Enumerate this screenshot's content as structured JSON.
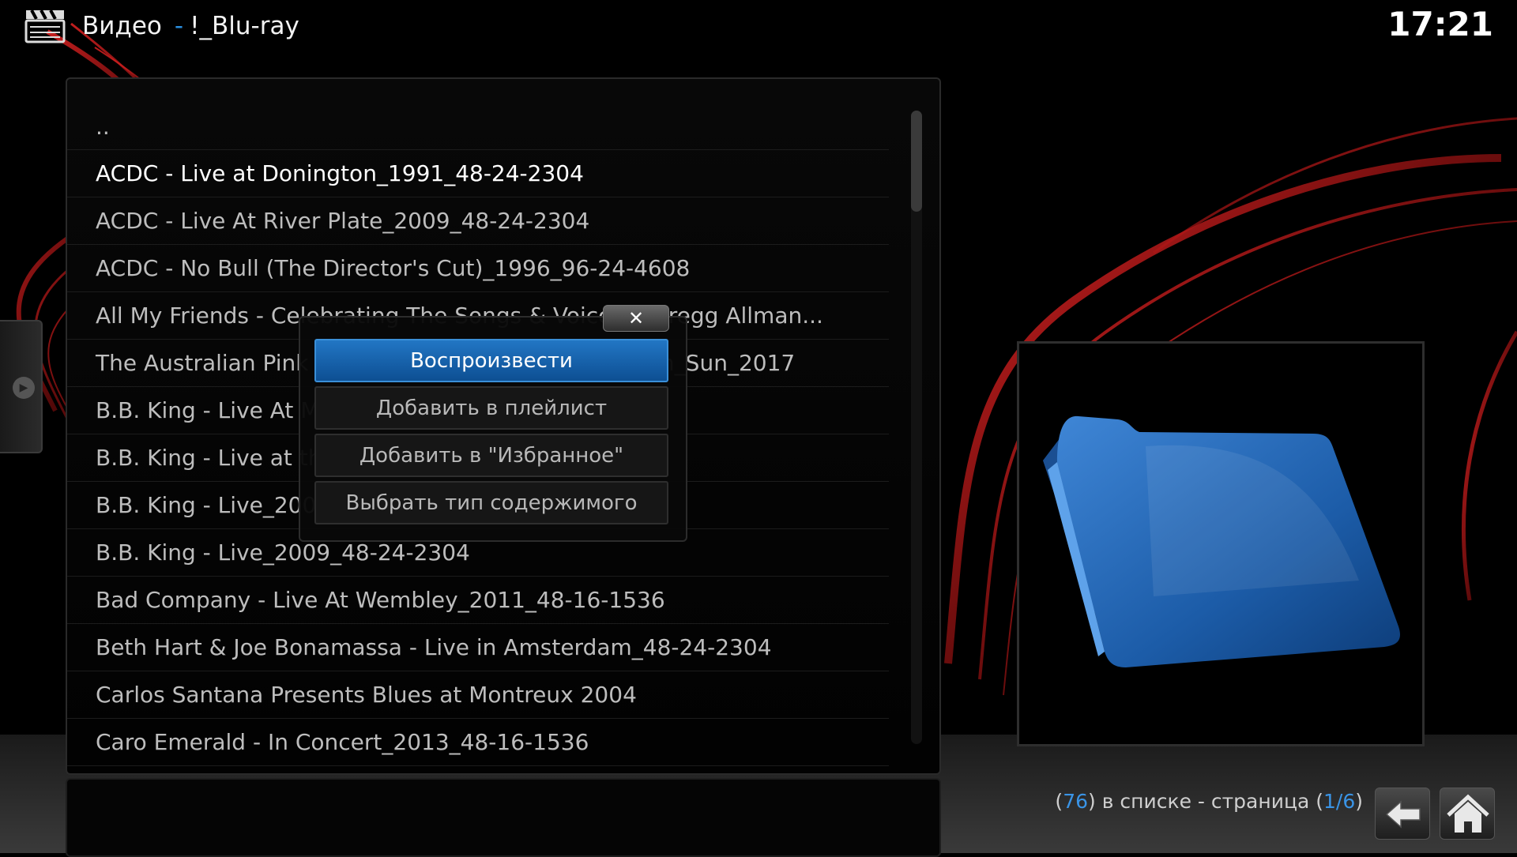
{
  "header": {
    "section_title": "Видео",
    "separator": "-",
    "folder_name": "!_Blu-ray",
    "icon": "clapperboard-icon"
  },
  "clock": "17:21",
  "list": {
    "items": [
      "..",
      "ACDC - Live at Donington_1991_48-24-2304",
      "ACDC - Live At River Plate_2009_48-24-2304",
      "ACDC - No Bull (The Director's Cut)_1996_96-24-4608",
      "All My Friends - Celebrating The Songs & Voice Of Gregg Allman...",
      "The Australian Pink Floyd Show - Eclipse_Wiesbaden_Sun_2017",
      "B.B. King - Live At M",
      "B.B. King - Live at th                                                      4",
      "B.B. King - Live_200",
      "B.B. King - Live_2009_48-24-2304",
      "Bad Company - Live At Wembley_2011_48-16-1536",
      "Beth Hart & Joe Bonamassa -  Live in Amsterdam_48-24-2304",
      "Carlos Santana Presents Blues at Montreux  2004",
      "Caro Emerald -  In Concert_2013_48-16-1536"
    ],
    "focused_index": 1
  },
  "context_menu": {
    "close_label": "✕",
    "items": [
      "Воспроизвести",
      "Добавить в плейлист",
      "Добавить в \"Избранное\"",
      "Выбрать тип содержимого"
    ],
    "active_index": 0
  },
  "thumbnail": {
    "icon": "folder-icon"
  },
  "footer": {
    "open_paren": "(",
    "item_count": "76",
    "text_mid": ") в списке - страница (",
    "page": "1/6",
    "close_paren": ")"
  },
  "nav": {
    "back_icon": "back-arrow-icon",
    "home_icon": "home-icon"
  },
  "colors": {
    "accent": "#2a8fe0",
    "focus_button": "#1866b0",
    "ribbon": "#c01010"
  }
}
